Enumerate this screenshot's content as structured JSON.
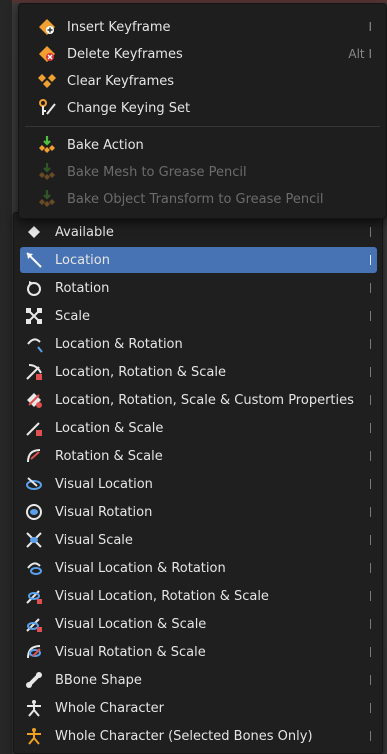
{
  "keyframe_menu": {
    "items": [
      {
        "label": "Insert Keyframe",
        "shortcut": "I",
        "icon": "keyframe-insert-icon",
        "disabled": false
      },
      {
        "label": "Delete Keyframes",
        "shortcut": "Alt I",
        "icon": "keyframe-delete-icon",
        "disabled": false
      },
      {
        "label": "Clear Keyframes",
        "shortcut": "",
        "icon": "keyframe-clear-icon",
        "disabled": false
      },
      {
        "label": "Change Keying Set",
        "shortcut": "",
        "icon": "keyingset-icon",
        "disabled": false
      },
      {
        "label": "Bake Action",
        "shortcut": "",
        "icon": "bake-action-icon",
        "disabled": false
      },
      {
        "label": "Bake Mesh to Grease Pencil",
        "shortcut": "",
        "icon": "bake-mesh-icon",
        "disabled": true
      },
      {
        "label": "Bake Object Transform to Grease Pencil",
        "shortcut": "",
        "icon": "bake-object-icon",
        "disabled": true
      }
    ]
  },
  "keying_set_menu": {
    "selected_index": 1,
    "items": [
      {
        "label": "Available",
        "icon": "available-diamond-icon"
      },
      {
        "label": "Location",
        "icon": "location-icon"
      },
      {
        "label": "Rotation",
        "icon": "rotation-icon"
      },
      {
        "label": "Scale",
        "icon": "scale-icon"
      },
      {
        "label": "Location & Rotation",
        "icon": "location-rotation-icon"
      },
      {
        "label": "Location, Rotation & Scale",
        "icon": "location-rotation-scale-icon"
      },
      {
        "label": "Location, Rotation, Scale & Custom Properties",
        "icon": "lrs-custom-props-icon"
      },
      {
        "label": "Location & Scale",
        "icon": "location-scale-icon"
      },
      {
        "label": "Rotation & Scale",
        "icon": "rotation-scale-icon"
      },
      {
        "label": "Visual Location",
        "icon": "visual-location-icon"
      },
      {
        "label": "Visual Rotation",
        "icon": "visual-rotation-icon"
      },
      {
        "label": "Visual Scale",
        "icon": "visual-scale-icon"
      },
      {
        "label": "Visual Location & Rotation",
        "icon": "visual-location-rotation-icon"
      },
      {
        "label": "Visual Location, Rotation & Scale",
        "icon": "visual-lrs-icon"
      },
      {
        "label": "Visual Location & Scale",
        "icon": "visual-location-scale-icon"
      },
      {
        "label": "Visual Rotation & Scale",
        "icon": "visual-rotation-scale-icon"
      },
      {
        "label": "BBone Shape",
        "icon": "bbone-shape-icon"
      },
      {
        "label": "Whole Character",
        "icon": "whole-character-icon"
      },
      {
        "label": "Whole Character (Selected Bones Only)",
        "icon": "whole-character-selected-icon"
      }
    ]
  },
  "colors": {
    "selection": "#4772b3",
    "menu_bg": "#1f1f1f",
    "disabled_text": "#6c6c6c"
  }
}
